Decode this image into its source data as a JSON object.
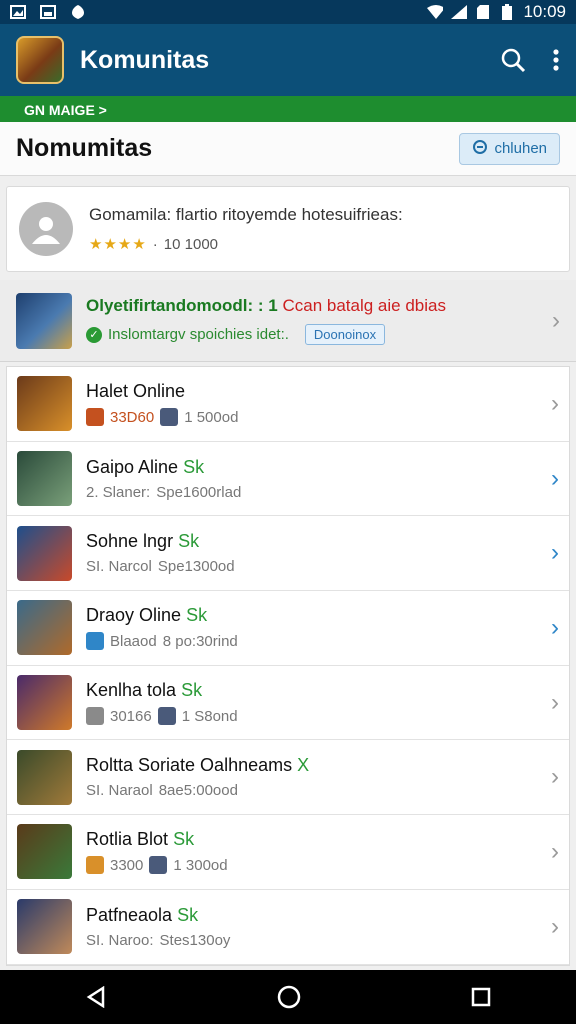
{
  "status_bar": {
    "time": "10:09",
    "icons": [
      "image-icon",
      "gallery-icon",
      "shield-icon",
      "wifi-icon",
      "signal-icon",
      "sd-icon",
      "battery-icon"
    ]
  },
  "app_bar": {
    "title": "Komunitas",
    "search_icon": "search-icon",
    "menu_icon": "more-vert-icon"
  },
  "green_bar": {
    "text": "GN MAIGE >"
  },
  "section": {
    "title": "Nomumitas",
    "button_label": "chluhen"
  },
  "profile_card": {
    "title": "Gomamila: flartio ritoyemde hotesuifrieas:",
    "stars": "★★★★",
    "count": "10 1000"
  },
  "featured": {
    "title_main": "Olyetifirtandomoodl: : 1",
    "title_red": "Ccan batalg aie dbias",
    "subtitle": "Inslomtargv spoichies idet:.",
    "tag": "Doonoinox"
  },
  "rows": [
    {
      "title": "Halet Online",
      "tagline": "",
      "sub_a": "33D60",
      "sub_b": "1 500od",
      "chevron_color": "#9a9a9a",
      "thumb": [
        "#6b3a1a",
        "#d9902a"
      ],
      "mini": "#c4511f",
      "mini_b": "#4a5a7a"
    },
    {
      "title": "Gaipo Aline",
      "tagline": "Sk",
      "sub_a": "2. Slaner:",
      "sub_b": "Spe1600rlad",
      "chevron_color": "#2f86c8",
      "thumb": [
        "#2a4a3a",
        "#7aa07a"
      ],
      "mini": "",
      "mini_b": ""
    },
    {
      "title": "Sohne lngr",
      "tagline": "Sk",
      "sub_a": "SI. Narcol",
      "sub_b": "Spe1300od",
      "chevron_color": "#2f86c8",
      "thumb": [
        "#1e4f8c",
        "#c94a2a"
      ],
      "mini": "",
      "mini_b": ""
    },
    {
      "title": "Draoy Oline",
      "tagline": "Sk",
      "sub_a": "Blaaod",
      "sub_b": "8 po:30rind",
      "chevron_color": "#2f86c8",
      "thumb": [
        "#3a6a8a",
        "#b06a2a"
      ],
      "mini": "#2f86c8",
      "mini_b": ""
    },
    {
      "title": "Kenlha tola",
      "tagline": "Sk",
      "sub_a": "30166",
      "sub_b": "1 S8ond",
      "chevron_color": "#9a9a9a",
      "thumb": [
        "#4a2a6a",
        "#d07a2a"
      ],
      "mini": "#8a8a8a",
      "mini_b": "#4a5a7a"
    },
    {
      "title": "Roltta Soriate Oalhneams",
      "tagline": "X",
      "sub_a": "SI. Naraol",
      "sub_b": "8ae5:00ood",
      "chevron_color": "#9a9a9a",
      "thumb": [
        "#3a4a2a",
        "#a07a3a"
      ],
      "mini": "",
      "mini_b": ""
    },
    {
      "title": "Rotlia Blot",
      "tagline": "Sk",
      "sub_a": "3300",
      "sub_b": "1 300od",
      "chevron_color": "#9a9a9a",
      "thumb": [
        "#5a3a1a",
        "#3a7a3a"
      ],
      "mini": "#d9902a",
      "mini_b": "#4a5a7a"
    },
    {
      "title": "Patfneaola",
      "tagline": "Sk",
      "sub_a": "SI. Naroo:",
      "sub_b": "Stes130oy",
      "chevron_color": "#9a9a9a",
      "thumb": [
        "#2a3a6a",
        "#c08a5a"
      ],
      "mini": "",
      "mini_b": ""
    }
  ],
  "nav_bar": {
    "icons": [
      "back-icon",
      "home-icon",
      "recents-icon"
    ]
  }
}
